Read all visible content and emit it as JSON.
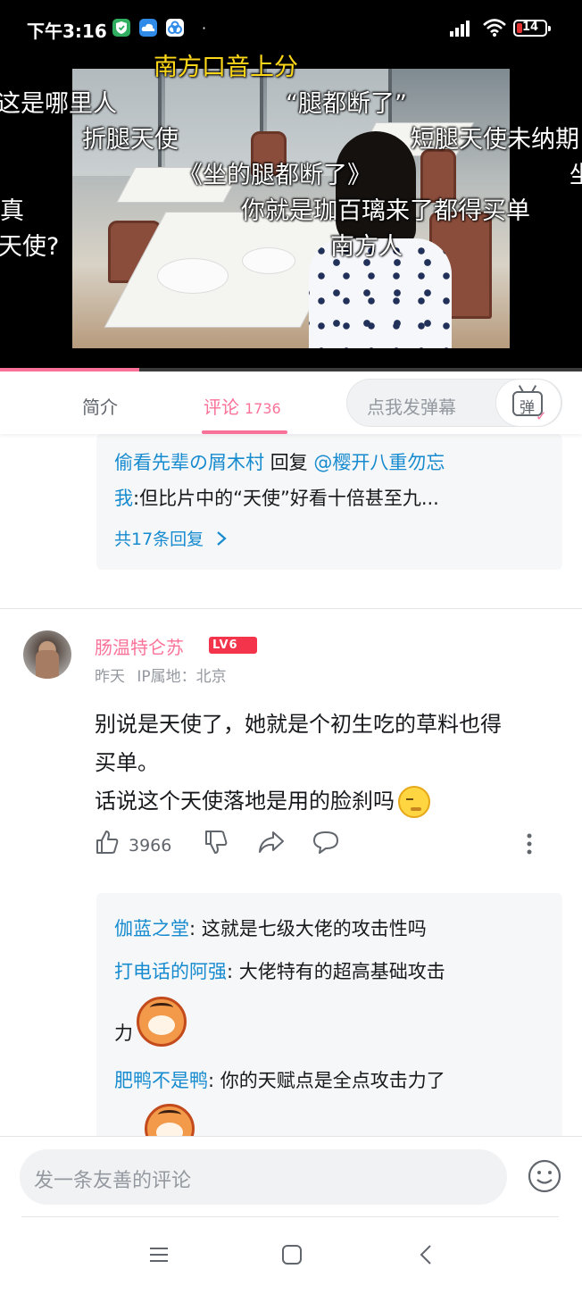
{
  "status_bar": {
    "time": "下午3:16",
    "battery": "14",
    "dot": "·",
    "app_icons": [
      "shield-app-icon",
      "cloud-app-icon",
      "link-app-icon"
    ]
  },
  "video": {
    "progress_fraction": 0.24,
    "danmaku": [
      "南方口音上分",
      "这是哪里人",
      "“腿都断了”",
      "折腿天使",
      "短腿天使未纳期",
      "《坐的腿都断了》",
      "坐",
      "真",
      "你就是珈百璃来了都得买单",
      "天使?",
      "南方人"
    ]
  },
  "tabs": {
    "intro": "简介",
    "comments": "评论",
    "comment_count": "1736",
    "danmaku_placeholder": "点我发弹幕",
    "danmaku_button": "弹"
  },
  "prev_comment_replies": {
    "reply_user": "偷看先辈の屑木村",
    "reply_word": "回复",
    "reply_target": "@樱开八重勿忘",
    "line2_user": "我",
    "line2_text": ":但比片中的“天使”好看十倍甚至九...",
    "more": "共17条回复"
  },
  "comment": {
    "author": "肠温特仑苏",
    "level": "LV6",
    "time": "昨天",
    "ip": "IP属地：北京",
    "text_line1": "别说是天使了，她就是个初生吃的草料也得",
    "text_line2": "买单。",
    "text_line3": "话说这个天使落地是用的脸刹吗",
    "likes": "3966"
  },
  "replies": [
    {
      "user": "伽蓝之堂",
      "text": ": 这就是七级大佬的攻击性吗"
    },
    {
      "user": "打电话的阿强",
      "text": ": 大佬特有的超高基础攻击",
      "cont": "力"
    },
    {
      "user": "肥鸭不是鸭",
      "text": ": 你的天赋点是全点攻击力了"
    }
  ],
  "bottom": {
    "comment_placeholder": "发一条友善的评论"
  },
  "colors": {
    "accent": "#fb7299",
    "link": "#178bcf",
    "level_badge": "#f3344b"
  }
}
